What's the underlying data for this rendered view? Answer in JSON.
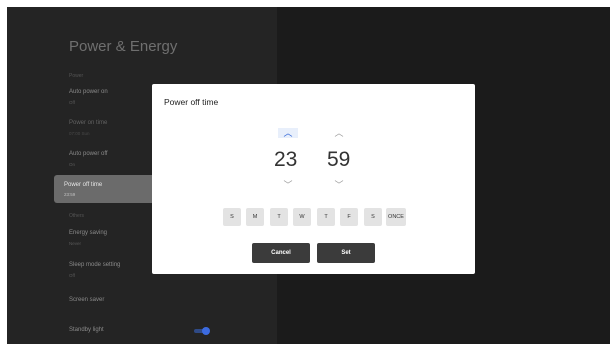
{
  "settings": {
    "title": "Power & Energy",
    "section_power": "Power",
    "items": [
      {
        "label": "Auto power on",
        "value": "Off"
      },
      {
        "label": "Power on time",
        "value": "07:00 Sun"
      },
      {
        "label": "Auto power off",
        "value": "On"
      },
      {
        "label": "Power off time",
        "value": "23:59"
      }
    ],
    "section_other": "Others",
    "items2": [
      {
        "label": "Energy saving",
        "value": "Never"
      },
      {
        "label": "Sleep mode setting",
        "value": "Off"
      },
      {
        "label": "Screen saver",
        "value": ""
      },
      {
        "label": "Standby light",
        "value": ""
      }
    ],
    "standby_light_on": true
  },
  "dialog": {
    "title": "Power off time",
    "hour": "23",
    "minute": "59",
    "up_glyph": "︿",
    "down_glyph": "﹀",
    "days": [
      "S",
      "M",
      "T",
      "W",
      "T",
      "F",
      "S",
      "ONCE"
    ],
    "cancel_label": "Cancel",
    "set_label": "Set"
  },
  "colors": {
    "accent": "#2f64d6",
    "selected_bg": "#6b6b6b",
    "button_bg": "#3b3b3b"
  }
}
